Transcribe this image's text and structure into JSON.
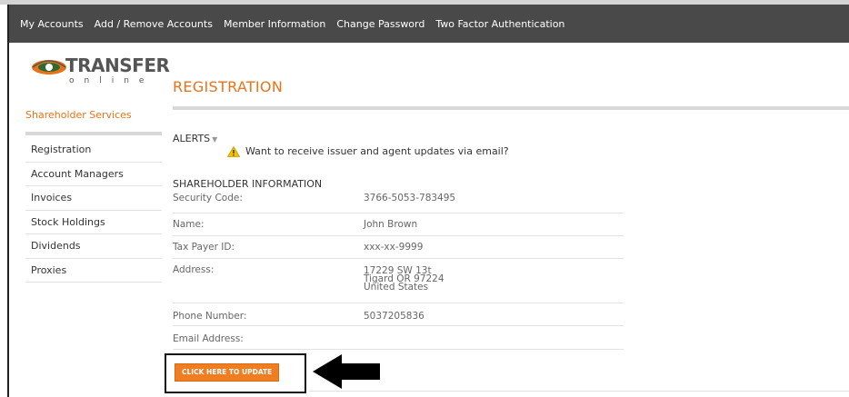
{
  "nav": {
    "items": [
      "My Accounts",
      "Add / Remove Accounts",
      "Member Information",
      "Change Password",
      "Two Factor Authentication"
    ]
  },
  "logo": {
    "name": "TRANSFER",
    "tagline": "online"
  },
  "sidebar": {
    "title": "Shareholder Services",
    "items": [
      "Registration",
      "Account Managers",
      "Invoices",
      "Stock Holdings",
      "Dividends",
      "Proxies"
    ]
  },
  "main": {
    "title": "REGISTRATION",
    "alerts_label": "ALERTS",
    "alert_text": "Want to receive issuer and agent updates via email?",
    "section_title": "SHAREHOLDER INFORMATION",
    "fields": [
      {
        "label": "Security Code:",
        "value": "3766-5053-783495"
      },
      {
        "label": "Name:",
        "value": "John Brown"
      },
      {
        "label": "Tax Payer ID:",
        "value": "xxx-xx-9999"
      },
      {
        "label": "Address:",
        "value": "17229 SW 13t\nTigard OR 97224\nUnited States"
      },
      {
        "label": "Phone Number:",
        "value": "5037205836"
      },
      {
        "label": "Email Address:",
        "value": ""
      }
    ],
    "update_button": "CLICK HERE TO UPDATE"
  },
  "colors": {
    "accent": "#e8731a",
    "button": "#ef7d22",
    "navbar": "#494949"
  }
}
